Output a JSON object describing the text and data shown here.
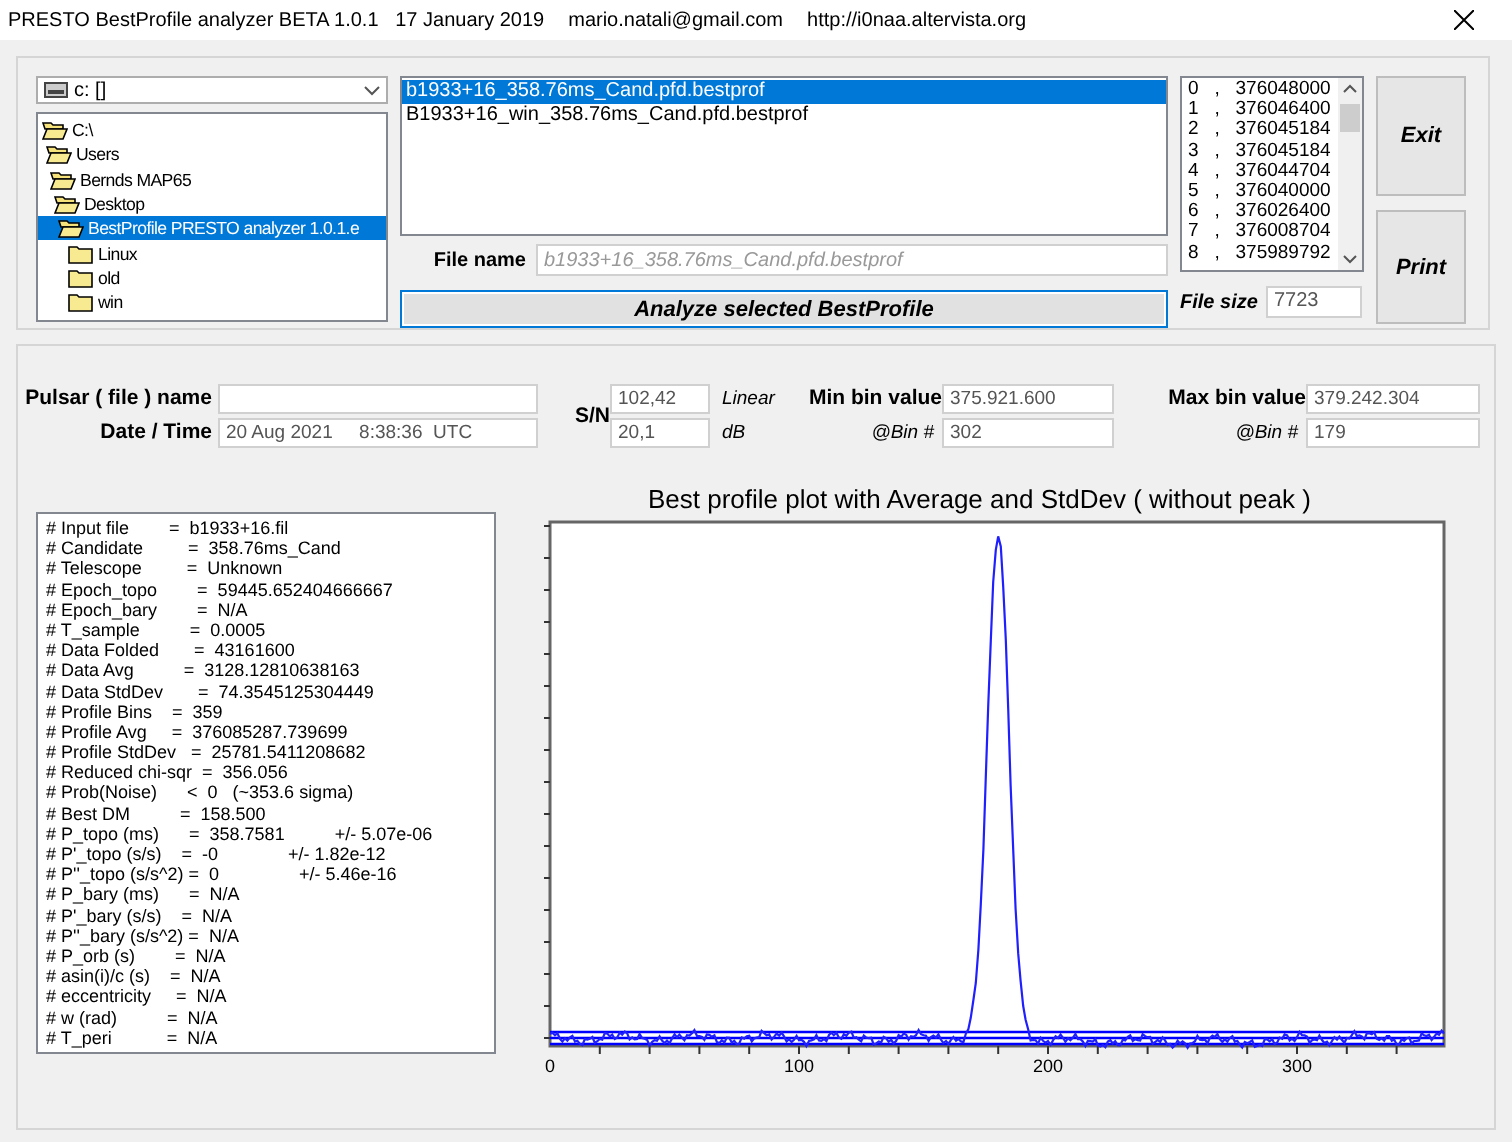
{
  "window": {
    "title": "PRESTO BestProfile analyzer BETA 1.0.1   17 January 2019",
    "email": "mario.natali@gmail.com",
    "url": "http://i0naa.altervista.org"
  },
  "drive": {
    "value": "c: []"
  },
  "folders": [
    {
      "name": "C:\\",
      "selected": false,
      "children": [
        {
          "name": "Users",
          "selected": false,
          "children": [
            {
              "name": "Bernds MAP65",
              "selected": false,
              "children": [
                {
                  "name": "Desktop",
                  "selected": false,
                  "children": [
                    {
                      "name": "BestProfile PRESTO analyzer 1.0.1.e",
                      "selected": true,
                      "children": [
                        {
                          "name": "Linux",
                          "selected": false
                        },
                        {
                          "name": "old",
                          "selected": false
                        },
                        {
                          "name": "win",
                          "selected": false
                        }
                      ]
                    }
                  ]
                }
              ]
            }
          ]
        }
      ]
    }
  ],
  "files": [
    {
      "name": "b1933+16_358.76ms_Cand.pfd.bestprof",
      "selected": true
    },
    {
      "name": "B1933+16_win_358.76ms_Cand.pfd.bestprof",
      "selected": false
    }
  ],
  "file_name": {
    "label": "File name",
    "placeholder": "b1933+16_358.76ms_Cand.pfd.bestprof"
  },
  "analyze_button": "Analyze selected BestProfile",
  "bins": [
    "0   ,   376048000",
    "1   ,   376046400",
    "2   ,   376045184",
    "3   ,   376045184",
    "4   ,   376044704",
    "5   ,   376040000",
    "6   ,   376026400",
    "7   ,   376008704",
    "8   ,   375989792"
  ],
  "file_size": {
    "label": "File size",
    "value": "7723"
  },
  "buttons": [
    "Exit",
    "Print"
  ],
  "pulsar": {
    "name_label": "Pulsar ( file ) name",
    "date_label": "Date / Time",
    "date_value": "20 Aug 2021     8:38:36  UTC"
  },
  "sn": {
    "label": "S/N",
    "linear_value": "102,42",
    "linear_unit": "Linear",
    "db_value": "20,1",
    "db_unit": "dB"
  },
  "min_bin": {
    "label": "Min bin value",
    "value": "375.921.600",
    "bin_label": "@Bin #",
    "bin": "302"
  },
  "max_bin": {
    "label": "Max bin value",
    "value": "379.242.304",
    "bin_label": "@Bin #",
    "bin": "179"
  },
  "stats": [
    "# Input file        =  b1933+16.fil",
    "# Candidate         =  358.76ms_Cand",
    "# Telescope         =  Unknown",
    "# Epoch_topo        =  59445.652404666667",
    "# Epoch_bary        =  N/A",
    "# T_sample          =  0.0005",
    "# Data Folded       =  43161600",
    "# Data Avg          =  3128.12810638163",
    "# Data StdDev       =  74.3545125304449",
    "# Profile Bins    =  359",
    "# Profile Avg     =  376085287.739699",
    "# Profile StdDev   =  25781.5411208682",
    "# Reduced chi-sqr  =  356.056",
    "# Prob(Noise)      <  0   (~353.6 sigma)",
    "# Best DM          =  158.500",
    "# P_topo (ms)      =  358.7581          +/- 5.07e-06",
    "# P'_topo (s/s)    =  -0              +/- 1.82e-12",
    "# P''_topo (s/s^2) =  0                +/- 5.46e-16",
    "# P_bary (ms)      =  N/A",
    "# P'_bary (s/s)    =  N/A",
    "# P''_bary (s/s^2) =  N/A",
    "# P_orb (s)        =  N/A",
    "# asin(i)/c (s)    =  N/A",
    "# eccentricity     =  N/A",
    "# w (rad)          =  N/A",
    "# T_peri           =  N/A"
  ],
  "plot": {
    "title": "Best profile plot with  Average and StdDev ( without peak )",
    "x_tick_labels": [
      "0",
      "100",
      "200",
      "300"
    ]
  }
}
